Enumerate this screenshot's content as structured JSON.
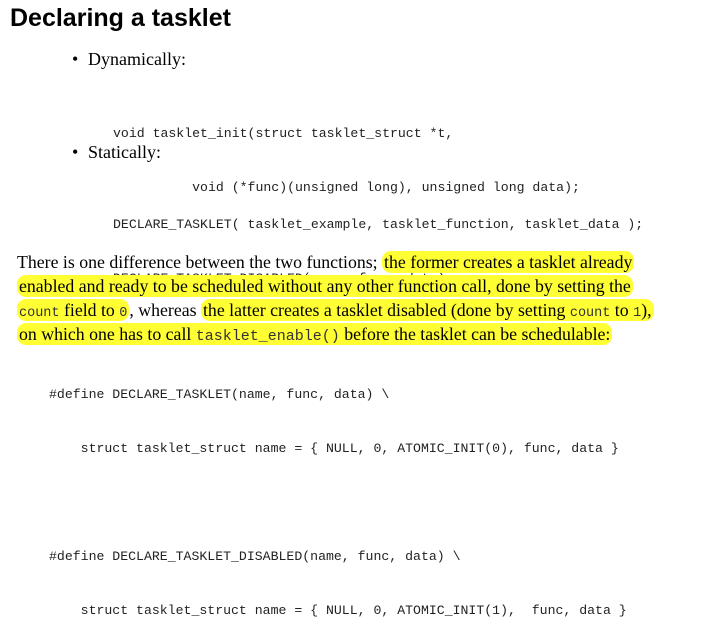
{
  "title": "Declaring a tasklet",
  "bullets": {
    "dynamic": "Dynamically:",
    "static": "Statically:"
  },
  "code_dynamic": [
    "void tasklet_init(struct tasklet_struct *t,",
    "          void (*func)(unsigned long), unsigned long data);"
  ],
  "code_static": [
    "DECLARE_TASKLET( tasklet_example, tasklet_function, tasklet_data );",
    "DECLARE_TASKLET_DISABLED(name, func, data);"
  ],
  "paragraph": {
    "l1_plain": "There is one difference between the two functions; ",
    "l1_hl": "the former creates a tasklet already",
    "l2_hl": "enabled and ready to be scheduled without any other function call, done by setting the",
    "l3_code1": "count",
    "l3_hl1": " field to ",
    "l3_code2": "0",
    "l3_plain": ", whereas ",
    "l3_hl2": "the latter creates a tasklet disabled (done by setting ",
    "l3_code3": "count",
    "l3_hl3": " to ",
    "l3_code4": "1",
    "l3_hl4": "),",
    "l4_hl1": "on which one has to call ",
    "l4_code": "tasklet_enable()",
    "l4_hl2": " before the tasklet can be schedulable:"
  },
  "code_defines": [
    "#define DECLARE_TASKLET(name, func, data) \\",
    "    struct tasklet_struct name = { NULL, 0, ATOMIC_INIT(0), func, data }",
    "",
    "#define DECLARE_TASKLET_DISABLED(name, func, data) \\",
    "    struct tasklet_struct name = { NULL, 0, ATOMIC_INIT(1),  func, data }"
  ],
  "colors": {
    "highlight": "#ffff33"
  }
}
